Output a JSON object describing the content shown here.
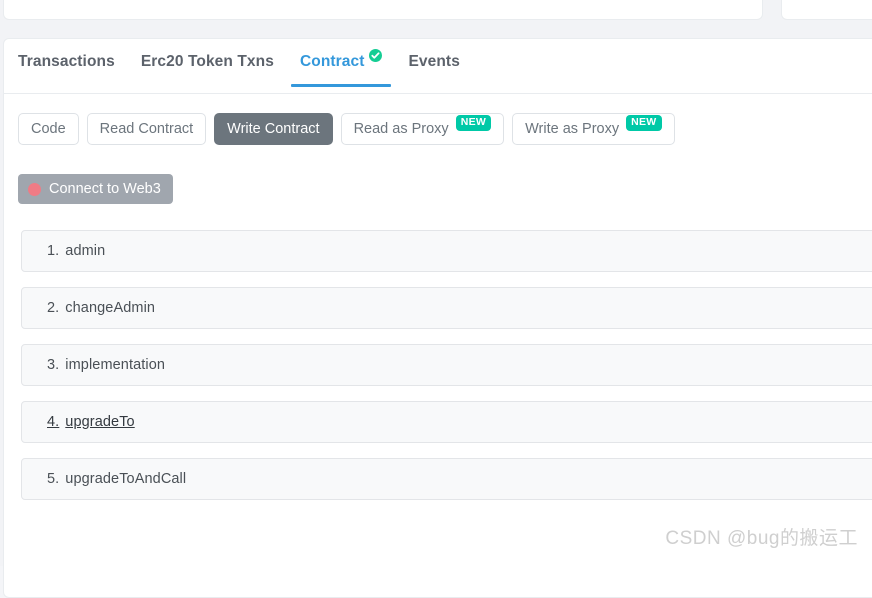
{
  "tabs": {
    "items": [
      {
        "label": "Transactions",
        "active": false,
        "verified": false
      },
      {
        "label": "Erc20 Token Txns",
        "active": false,
        "verified": false
      },
      {
        "label": "Contract",
        "active": true,
        "verified": true
      },
      {
        "label": "Events",
        "active": false,
        "verified": false
      }
    ],
    "active_color": "#3498db",
    "verified_icon": "verified-check-icon",
    "verified_color": "#15cd94"
  },
  "subtabs": {
    "items": [
      {
        "label": "Code",
        "active": false,
        "badge": null
      },
      {
        "label": "Read Contract",
        "active": false,
        "badge": null
      },
      {
        "label": "Write Contract",
        "active": true,
        "badge": null
      },
      {
        "label": "Read as Proxy",
        "active": false,
        "badge": "NEW"
      },
      {
        "label": "Write as Proxy",
        "active": false,
        "badge": "NEW"
      }
    ],
    "active_bg": "#6c757d",
    "badge_color": "#00c9a7"
  },
  "connect": {
    "label": "Connect to Web3",
    "icon": "status-dot-icon",
    "status_color": "#ef7b85",
    "button_color": "#a0a6ae"
  },
  "functions": {
    "items": [
      {
        "index": "1.",
        "name": "admin",
        "hovered": false
      },
      {
        "index": "2.",
        "name": "changeAdmin",
        "hovered": false
      },
      {
        "index": "3.",
        "name": "implementation",
        "hovered": false
      },
      {
        "index": "4.",
        "name": "upgradeTo",
        "hovered": true
      },
      {
        "index": "5.",
        "name": "upgradeToAndCall",
        "hovered": false
      }
    ]
  },
  "watermark": {
    "text": "CSDN @bug的搬运工"
  }
}
